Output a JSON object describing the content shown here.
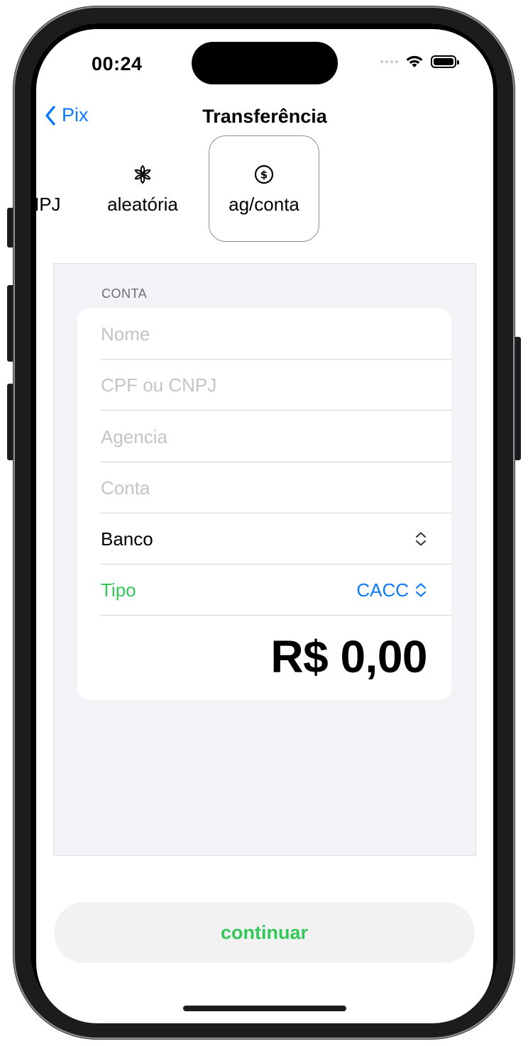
{
  "status_bar": {
    "time": "00:24"
  },
  "nav": {
    "back_label": "Pix",
    "title": "Transferência"
  },
  "key_types": [
    {
      "label": "NPJ",
      "icon": "none"
    },
    {
      "label": "aleatória",
      "icon": "asterisk-icon"
    },
    {
      "label": "ag/conta",
      "icon": "dollar-circle-icon",
      "selected": true
    }
  ],
  "form": {
    "section_header": "CONTA",
    "fields": {
      "nome_placeholder": "Nome",
      "cpf_placeholder": "CPF ou CNPJ",
      "agencia_placeholder": "Agencia",
      "conta_placeholder": "Conta"
    },
    "banco_label": "Banco",
    "tipo_label": "Tipo",
    "tipo_value": "CACC",
    "amount": "R$ 0,00"
  },
  "continue_label": "continuar",
  "colors": {
    "accent_blue": "#0a7aff",
    "accent_green": "#34c759",
    "form_bg": "#f2f2f7"
  }
}
